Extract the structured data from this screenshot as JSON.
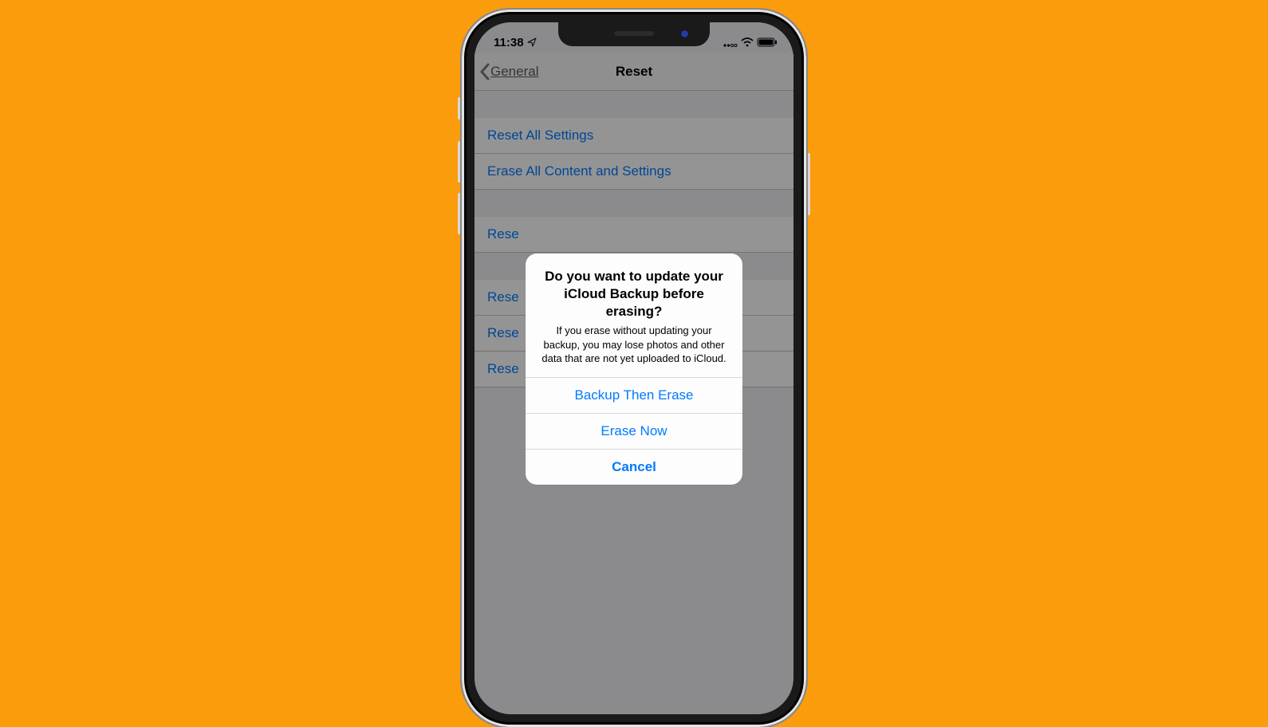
{
  "status": {
    "time": "11:38",
    "location_icon": "location-arrow",
    "signal_icon": "cellular",
    "wifi_icon": "wifi",
    "battery_icon": "battery"
  },
  "nav": {
    "back_label": "General",
    "title": "Reset"
  },
  "rows": {
    "r1": "Reset All Settings",
    "r2": "Erase All Content and Settings",
    "r3": "Rese",
    "r4": "Rese",
    "r5": "Rese",
    "r6": "Rese"
  },
  "alert": {
    "title": "Do you want to update your iCloud Backup before erasing?",
    "message": "If you erase without updating your backup, you may lose photos and other data that are not yet uploaded to iCloud.",
    "btn1": "Backup Then Erase",
    "btn2": "Erase Now",
    "btn3": "Cancel"
  }
}
